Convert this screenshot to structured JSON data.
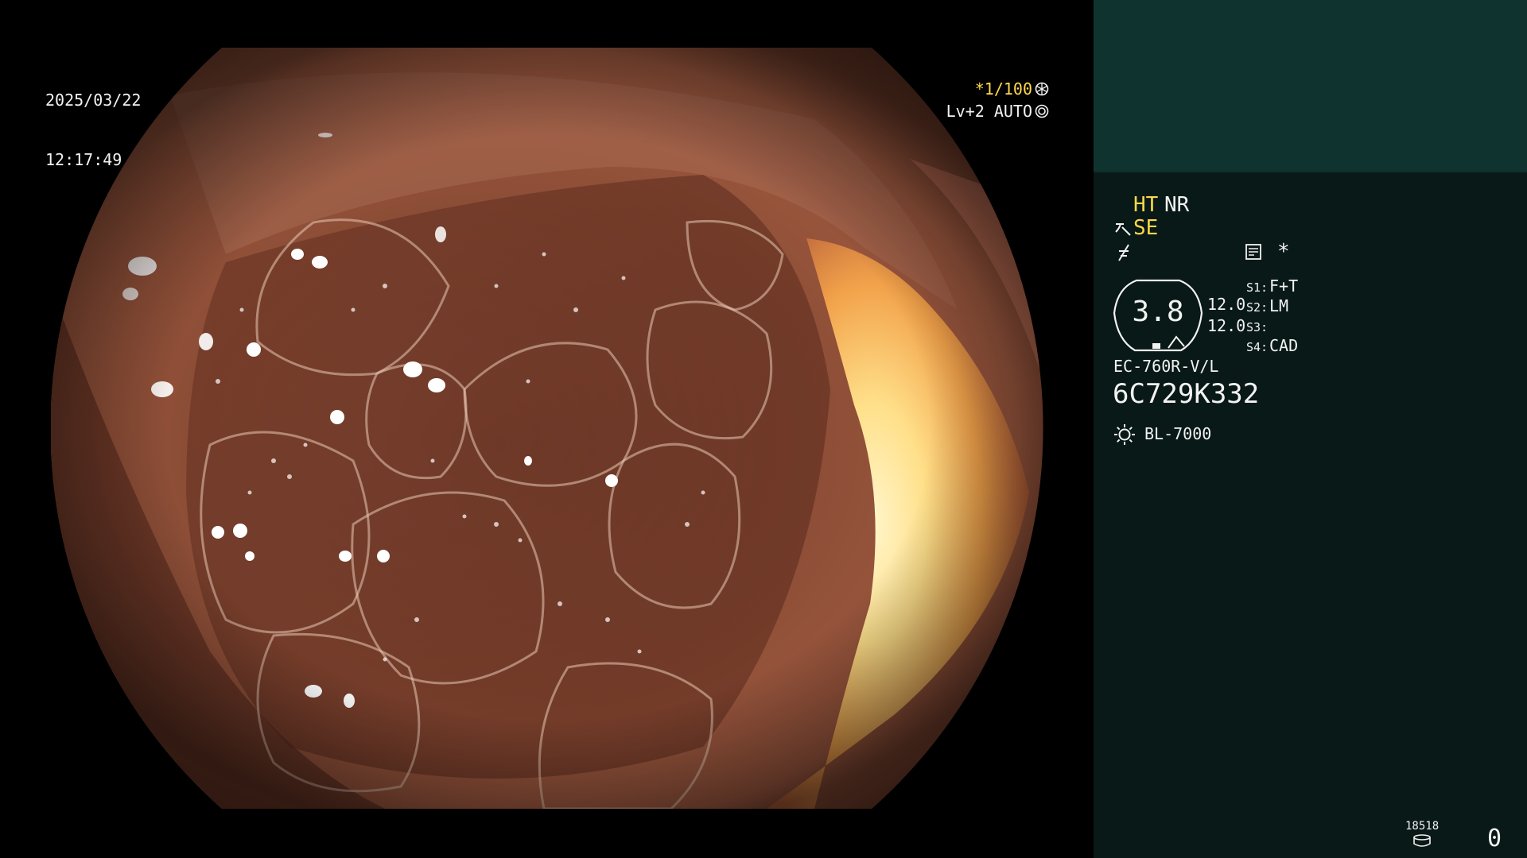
{
  "capture": {
    "date": "2025/03/22",
    "time": "12:17:49"
  },
  "overlay": {
    "exposure": "*1/100",
    "exposure_icon": "shutter-ring-icon",
    "level": "Lv+2 AUTO",
    "level_icon": "iris-ring-icon"
  },
  "panel": {
    "modes": {
      "ht": "HT",
      "nr": "NR",
      "se": "SE",
      "se_icon": "enhance-icon",
      "freeze_icon": "freeze-icon",
      "memo_icon": "memo-icon",
      "star": "*"
    },
    "gauge": {
      "value": "3.8",
      "val1": "12.0",
      "val2": "12.0"
    },
    "switches": [
      {
        "key": "S1:",
        "value": "F+T"
      },
      {
        "key": "S2:",
        "value": "LM"
      },
      {
        "key": "S3:",
        "value": ""
      },
      {
        "key": "S4:",
        "value": "CAD"
      }
    ],
    "scope_model": "EC-760R-V/L",
    "scope_serial": "6C729K332",
    "light_source": "BL-7000",
    "light_icon": "sun-icon",
    "counter": {
      "number": "18518",
      "value": "0",
      "icon": "storage-icon"
    }
  },
  "colors": {
    "accent_yellow": "#ffd84a",
    "text": "#f2f2f2",
    "panel_bg": "#081917",
    "panel_top_bg": "#0f3430"
  }
}
